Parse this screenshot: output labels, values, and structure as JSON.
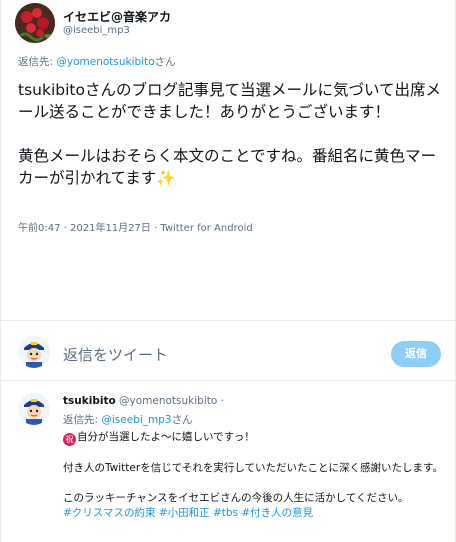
{
  "tweet": {
    "author_name": "イセエビ@音楽アカ",
    "author_handle": "@iseebi_mp3",
    "reply_to_label": "返信先: ",
    "reply_to_handle": "@yomenotsukibito",
    "reply_to_suffix": "さん",
    "text_line1": "tsukibitoさんのブログ記事見て当選メールに気づいて出席メール送ることができました！ありがとうございます！",
    "text_line2": "黄色メールはおそらく本文のことですね。番組名に黄色マーカーが引かれてます",
    "sparkle_emoji": "✨",
    "meta": "午前0:47 · 2021年11月27日 · Twitter for Android"
  },
  "composer": {
    "placeholder": "返信をツイート",
    "reply_button": "返信"
  },
  "reply": {
    "author_name": "tsukibito",
    "author_handle": "@yomenotsukibito ·",
    "reply_to_label": "返信先: ",
    "reply_to_handle": "@iseebi_mp3",
    "reply_to_suffix": "さん",
    "badge_glyph": "祝",
    "line1": "自分が当選したよ〜に嬉しいですっ！",
    "line2": "付き人のTwitterを信じてそれを実行していただいたことに深く感謝いたします。",
    "line3": "このラッキーチャンスをイセエビさんの今後の人生に活かしてください。",
    "hashtags": "#クリスマスの約束 #小田和正 #tbs #付き人の意見"
  },
  "colors": {
    "link": "#1b95e0",
    "muted": "#5b7083",
    "reply_button_bg": "#8ecdf7"
  }
}
